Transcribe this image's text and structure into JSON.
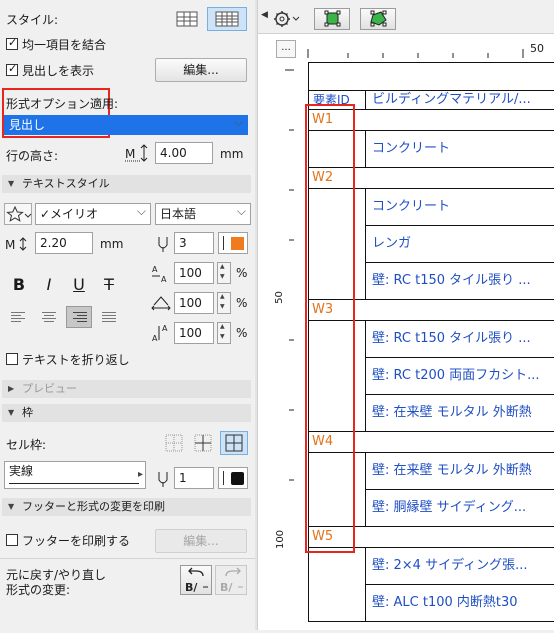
{
  "left": {
    "style_label": "スタイル:",
    "merge_label": "均一項目を結合",
    "merge_checked": true,
    "show_header_label": "見出しを表示",
    "show_header_checked": true,
    "edit_label": "編集...",
    "format_apply_label": "形式オプション適用:",
    "format_apply_value": "見出し",
    "row_height_label": "行の高さ:",
    "row_height_value": "4.00",
    "row_height_unit": "mm",
    "text_style_section": "テキストスタイル",
    "font_value": "✓メイリオ",
    "language_value": "日本語",
    "font_size_value": "2.20",
    "font_size_unit": "mm",
    "pen_value": "3",
    "pen_color": "#f07a1e",
    "width_pct": "100",
    "spacing_pct": "100",
    "height_pct": "100",
    "pct_unit": "%",
    "wrap_label": "テキストを折り返し",
    "wrap_checked": false,
    "preview_section": "プレビュー",
    "frame_section": "枠",
    "cell_frame_label": "セル枠:",
    "line_type_value": "実線",
    "frame_pen_value": "1",
    "frame_pen_color": "#111111",
    "print_section": "フッターと形式の変更を印刷",
    "print_footer_label": "フッターを印刷する",
    "print_footer_checked": false,
    "edit_disabled_label": "編集...",
    "undo_label_1": "元に戻す/やり直し",
    "undo_label_2": "形式の変更:"
  },
  "right": {
    "ruler_label_50": "50",
    "ruler_label_v50": "50",
    "ruler_label_v100": "100",
    "more_label": "...",
    "header": {
      "id": "要素ID",
      "material": "ビルディングマテリアル/..."
    },
    "groups": [
      {
        "id": "W1",
        "items": [
          "コンクリート"
        ]
      },
      {
        "id": "W2",
        "items": [
          "コンクリート",
          "レンガ",
          "壁: RC t150 タイル張り ..."
        ]
      },
      {
        "id": "W3",
        "items": [
          "壁: RC t150 タイル張り ...",
          "壁: RC t200 両面フカシト...",
          "壁: 在来壁 モルタル 外断熱"
        ]
      },
      {
        "id": "W4",
        "items": [
          "壁: 在来壁 モルタル 外断熱",
          "壁: 胴縁壁 サイディング..."
        ]
      },
      {
        "id": "W5",
        "items": [
          "壁: 2×4 サイディング張...",
          "壁: ALC t100 内断熱t30"
        ]
      }
    ]
  },
  "colors": {
    "highlight": "#e8261f",
    "selection": "#1e73e8",
    "group_text": "#e2731a",
    "item_text": "#1f4fc4"
  }
}
